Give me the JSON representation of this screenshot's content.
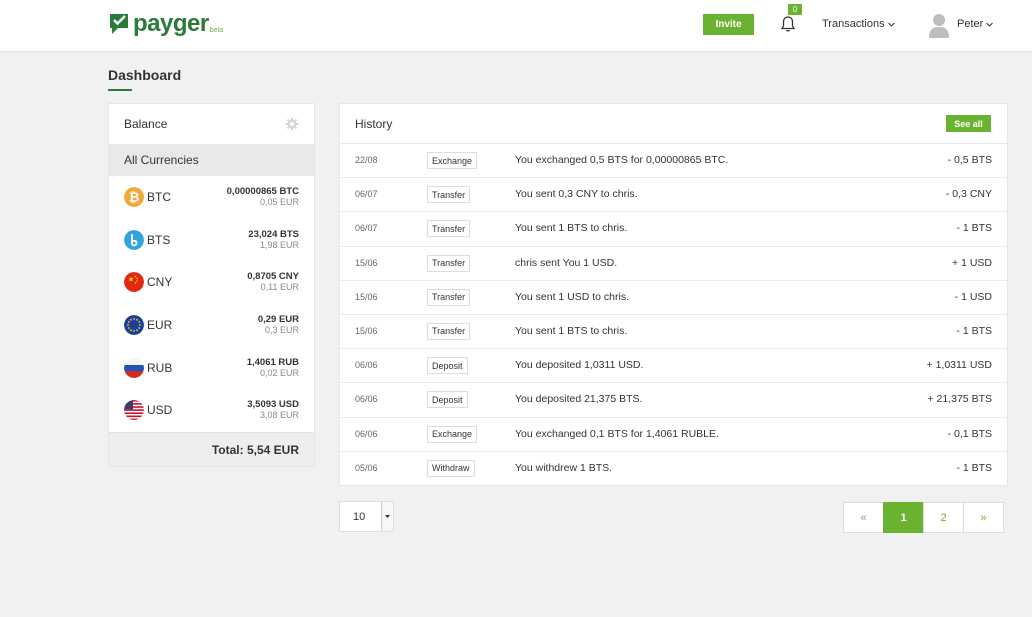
{
  "header": {
    "logo_text": "payger",
    "logo_beta": "beta",
    "invite_label": "Invite",
    "notification_count": "0",
    "transactions_label": "Transactions",
    "user_name": "Peter",
    "brand_color": "#2c7a3a",
    "accent_color": "#6ab330"
  },
  "page": {
    "title": "Dashboard"
  },
  "balance": {
    "title": "Balance",
    "all_currencies_label": "All Currencies",
    "currencies": [
      {
        "code": "BTC",
        "amount": "0,00000865 BTC",
        "eur": "0,05 EUR",
        "icon": "bitcoin-icon"
      },
      {
        "code": "BTS",
        "amount": "23,024 BTS",
        "eur": "1,98 EUR",
        "icon": "bitshares-icon"
      },
      {
        "code": "CNY",
        "amount": "0,8705 CNY",
        "eur": "0,11 EUR",
        "icon": "china-flag-icon"
      },
      {
        "code": "EUR",
        "amount": "0,29 EUR",
        "eur": "0,3 EUR",
        "icon": "eu-flag-icon"
      },
      {
        "code": "RUB",
        "amount": "1,4061 RUB",
        "eur": "0,02 EUR",
        "icon": "russia-flag-icon"
      },
      {
        "code": "USD",
        "amount": "3,5093 USD",
        "eur": "3,08 EUR",
        "icon": "usa-flag-icon"
      }
    ],
    "total_label": "Total: 5,54 EUR"
  },
  "history": {
    "title": "History",
    "see_all_label": "See all",
    "rows": [
      {
        "date": "22/08",
        "type": "Exchange",
        "desc": "You exchanged 0,5 BTS for 0,00000865 BTC.",
        "amount": "- 0,5 BTS"
      },
      {
        "date": "06/07",
        "type": "Transfer",
        "desc": "You sent 0,3 CNY to chris.",
        "amount": "- 0,3 CNY"
      },
      {
        "date": "06/07",
        "type": "Transfer",
        "desc": "You sent 1 BTS to chris.",
        "amount": "- 1 BTS"
      },
      {
        "date": "15/06",
        "type": "Transfer",
        "desc": "chris sent You 1 USD.",
        "amount": "+ 1 USD"
      },
      {
        "date": "15/06",
        "type": "Transfer",
        "desc": "You sent 1 USD to chris.",
        "amount": "- 1 USD"
      },
      {
        "date": "15/06",
        "type": "Transfer",
        "desc": "You sent 1 BTS to chris.",
        "amount": "- 1 BTS"
      },
      {
        "date": "06/06",
        "type": "Deposit",
        "desc": "You deposited 1,0311 USD.",
        "amount": "+ 1,0311 USD"
      },
      {
        "date": "06/06",
        "type": "Deposit",
        "desc": "You deposited 21,375 BTS.",
        "amount": "+ 21,375 BTS"
      },
      {
        "date": "06/06",
        "type": "Exchange",
        "desc": "You exchanged 0,1 BTS for 1,4061 RUBLE.",
        "amount": "- 0,1 BTS"
      },
      {
        "date": "05/06",
        "type": "Withdraw",
        "desc": "You withdrew 1 BTS.",
        "amount": "- 1 BTS"
      }
    ]
  },
  "per_page": {
    "value": "10"
  },
  "pagination": {
    "prev": "«",
    "pages": [
      "1",
      "2"
    ],
    "active_page": "1",
    "next": "»"
  }
}
